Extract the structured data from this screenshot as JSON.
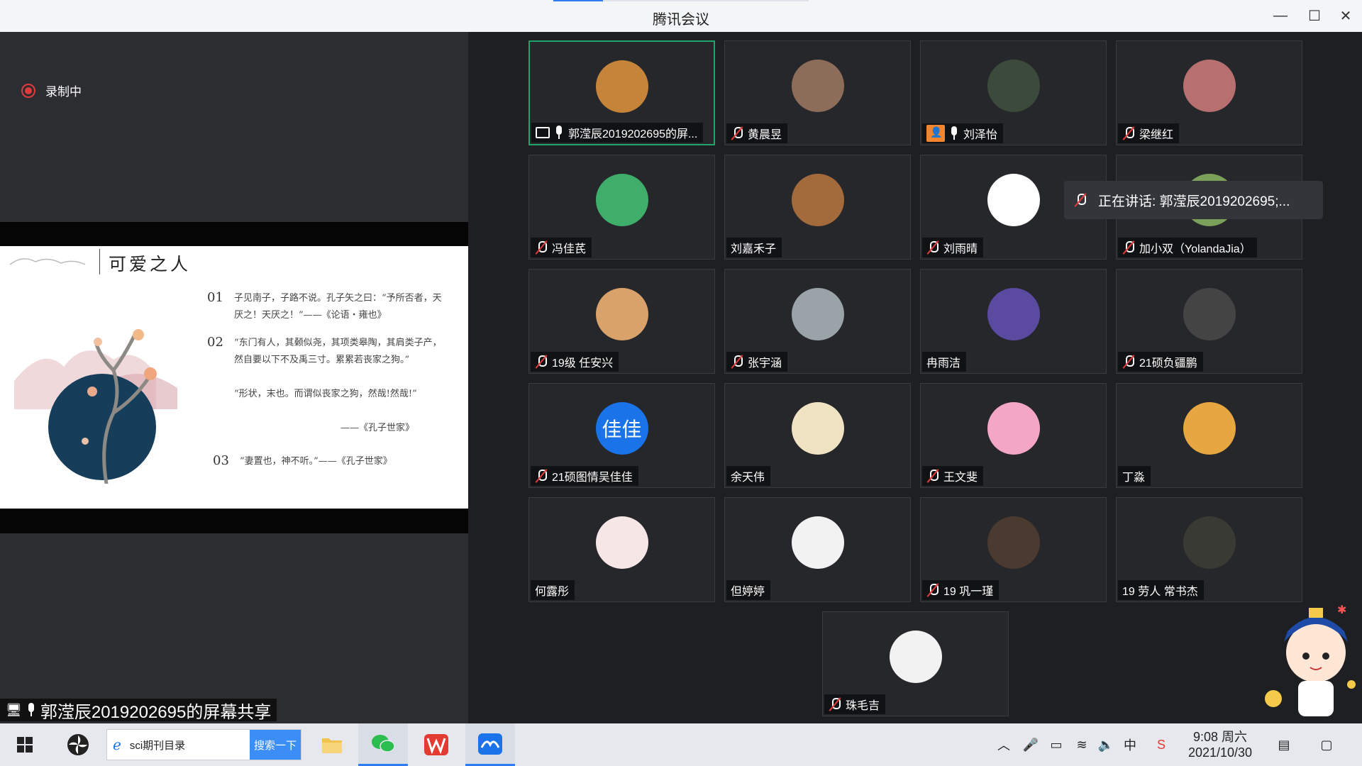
{
  "window": {
    "title": "腾讯会议",
    "minimize_glyph": "—",
    "maximize_glyph": "☐",
    "close_glyph": "✕"
  },
  "recording": {
    "label": "录制中"
  },
  "slide": {
    "title": "可爱之人",
    "items": [
      {
        "num": "01",
        "text": "子见南子，子路不说。孔子矢之曰：“予所否者，天厌之！天厌之！”——《论语・雍也》"
      },
      {
        "num": "02",
        "text": "“东门有人，其颡似尧，其项类皋陶，其肩类子产，然自要以下不及禹三寸。累累若丧家之狗。”"
      },
      {
        "num": "",
        "text": "“形状，末也。而谓似丧家之狗，然哉!然哉!”"
      },
      {
        "num": "",
        "text": "——《孔子世家》"
      },
      {
        "num": "03",
        "text": "“妻置也，神不听。”——《孔子世家》"
      }
    ]
  },
  "screen_share_label": "郭滢辰2019202695的屏幕共享",
  "speaking_toast": "正在讲话: 郭滢辰2019202695;...",
  "participants": [
    {
      "name": "郭滢辰2019202695的屏...",
      "mic": "on",
      "sharing": true,
      "active": true,
      "avatar_color": "#c6843a"
    },
    {
      "name": "黄晨昱",
      "mic": "muted",
      "avatar_color": "#8b6d5a"
    },
    {
      "name": "刘泽怡",
      "mic": "on",
      "cam_off": true,
      "avatar_color": "#3b4a3b"
    },
    {
      "name": "梁继红",
      "mic": "muted",
      "avatar_color": "#b86f6f"
    },
    {
      "name": "冯佳芪",
      "mic": "muted",
      "avatar_color": "#3fae6a"
    },
    {
      "name": "刘嘉禾子",
      "mic": "none",
      "avatar_color": "#a36a3c"
    },
    {
      "name": "刘雨晴",
      "mic": "muted",
      "avatar_color": "#ffffff"
    },
    {
      "name": "加小双（YolandaJia）",
      "mic": "muted",
      "avatar_color": "#7aa05a"
    },
    {
      "name": "19级 任安兴",
      "mic": "muted",
      "avatar_color": "#d8a26a"
    },
    {
      "name": "张宇涵",
      "mic": "muted",
      "avatar_color": "#9aa3a8"
    },
    {
      "name": "冉雨洁",
      "mic": "none",
      "avatar_color": "#5a4aa0"
    },
    {
      "name": "21硕负疆鹏",
      "mic": "muted",
      "avatar_color": "#444444"
    },
    {
      "name": "21硕图情吴佳佳",
      "mic": "muted",
      "avatar_text": "佳佳",
      "avatar_color": "#1a73e8"
    },
    {
      "name": "余天伟",
      "mic": "none",
      "avatar_color": "#efe3c4"
    },
    {
      "name": "王文斐",
      "mic": "muted",
      "avatar_color": "#f4a6c6"
    },
    {
      "name": "丁淼",
      "mic": "none",
      "avatar_color": "#e6a640"
    },
    {
      "name": "何露彤",
      "mic": "none",
      "avatar_color": "#f7e6e6"
    },
    {
      "name": "但婷婷",
      "mic": "none",
      "avatar_color": "#f2f2f2"
    },
    {
      "name": "19 巩一瑾",
      "mic": "muted",
      "avatar_color": "#4a3a30"
    },
    {
      "name": "19 劳人 常书杰",
      "mic": "none",
      "avatar_color": "#3a3a34"
    },
    {
      "name": "珠毛吉",
      "mic": "muted",
      "avatar_color": "#f2f2f2"
    }
  ],
  "taskbar": {
    "search_text": "sci期刊目录",
    "search_button": "搜索一下",
    "time": "9:08 周六",
    "date": "2021/10/30",
    "ime": "中"
  }
}
